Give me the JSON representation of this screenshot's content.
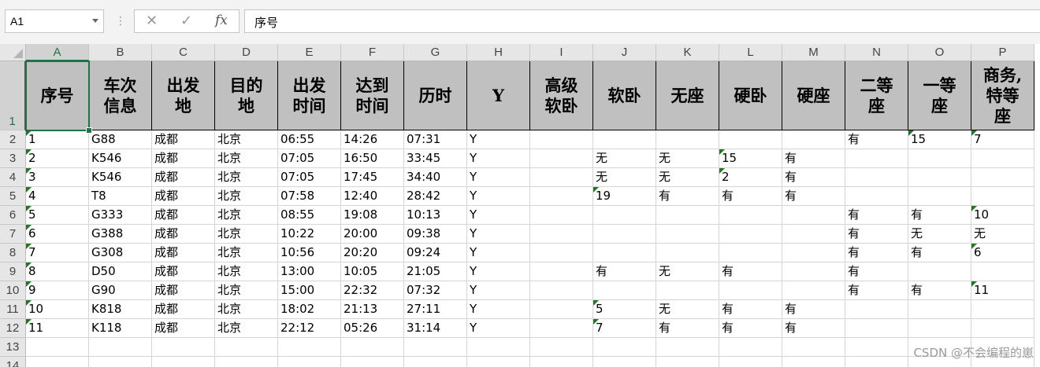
{
  "formula_bar": {
    "name_box": "A1",
    "cancel_icon": "✕",
    "enter_icon": "✓",
    "fx_label": "fx",
    "formula_value": "序号"
  },
  "columns": [
    "A",
    "B",
    "C",
    "D",
    "E",
    "F",
    "G",
    "H",
    "I",
    "J",
    "K",
    "L",
    "M",
    "N",
    "O",
    "P"
  ],
  "rows_numbers": [
    "1",
    "2",
    "3",
    "4",
    "5",
    "6",
    "7",
    "8",
    "9",
    "10",
    "11",
    "12",
    "13",
    "14"
  ],
  "header_row": [
    "序号",
    "车次\n信息",
    "出发\n地",
    "目的\n地",
    "出发\n时间",
    "达到\n时间",
    "历时",
    "Y",
    "高级\n软卧",
    "软卧",
    "无座",
    "硬卧",
    "硬座",
    "二等\n座",
    "一等\n座",
    "商务,\n特等\n座"
  ],
  "data_rows": [
    [
      "1",
      "G88",
      "成都",
      "北京",
      "06:55",
      "14:26",
      "07:31",
      "Y",
      "",
      "",
      "",
      "",
      "",
      "有",
      "15",
      "7"
    ],
    [
      "2",
      "K546",
      "成都",
      "北京",
      "07:05",
      "16:50",
      "33:45",
      "Y",
      "",
      "无",
      "无",
      "15",
      "有",
      "",
      "",
      ""
    ],
    [
      "3",
      "K546",
      "成都",
      "北京",
      "07:05",
      "17:45",
      "34:40",
      "Y",
      "",
      "无",
      "无",
      "2",
      "有",
      "",
      "",
      ""
    ],
    [
      "4",
      "T8",
      "成都",
      "北京",
      "07:58",
      "12:40",
      "28:42",
      "Y",
      "",
      "19",
      "有",
      "有",
      "有",
      "",
      "",
      ""
    ],
    [
      "5",
      "G333",
      "成都",
      "北京",
      "08:55",
      "19:08",
      "10:13",
      "Y",
      "",
      "",
      "",
      "",
      "",
      "有",
      "有",
      "10"
    ],
    [
      "6",
      "G388",
      "成都",
      "北京",
      "10:22",
      "20:00",
      "09:38",
      "Y",
      "",
      "",
      "",
      "",
      "",
      "有",
      "无",
      "无"
    ],
    [
      "7",
      "G308",
      "成都",
      "北京",
      "10:56",
      "20:20",
      "09:24",
      "Y",
      "",
      "",
      "",
      "",
      "",
      "有",
      "有",
      "6"
    ],
    [
      "8",
      "D50",
      "成都",
      "北京",
      "13:00",
      "10:05",
      "21:05",
      "Y",
      "",
      "有",
      "无",
      "有",
      "",
      "有",
      "",
      ""
    ],
    [
      "9",
      "G90",
      "成都",
      "北京",
      "15:00",
      "22:32",
      "07:32",
      "Y",
      "",
      "",
      "",
      "",
      "",
      "有",
      "有",
      "11"
    ],
    [
      "10",
      "K818",
      "成都",
      "北京",
      "18:02",
      "21:13",
      "27:11",
      "Y",
      "",
      "5",
      "无",
      "有",
      "有",
      "",
      "",
      ""
    ],
    [
      "11",
      "K118",
      "成都",
      "北京",
      "22:12",
      "05:26",
      "31:14",
      "Y",
      "",
      "7",
      "有",
      "有",
      "有",
      "",
      "",
      ""
    ]
  ],
  "watermark": "CSDN @不会编程的崽",
  "colors": {
    "accent": "#217346",
    "header_fill": "#c0c0c0",
    "number_flag": "#1e7a1e"
  }
}
